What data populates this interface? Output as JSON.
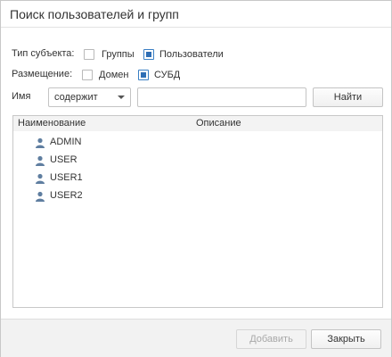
{
  "dialog": {
    "title": "Поиск пользователей и групп"
  },
  "filters": {
    "subject_type_label": "Тип субъекта:",
    "groups_label": "Группы",
    "groups_checked": false,
    "users_label": "Пользователи",
    "users_checked": true,
    "placement_label": "Размещение:",
    "domain_label": "Домен",
    "domain_checked": false,
    "dbms_label": "СУБД",
    "dbms_checked": true
  },
  "search": {
    "name_label": "Имя",
    "condition_value": "содержит",
    "query_value": "",
    "find_label": "Найти"
  },
  "table": {
    "columns": [
      "Наименование",
      "Описание"
    ],
    "rows": [
      {
        "name": "ADMIN",
        "description": ""
      },
      {
        "name": "USER",
        "description": ""
      },
      {
        "name": "USER1",
        "description": ""
      },
      {
        "name": "USER2",
        "description": ""
      }
    ]
  },
  "footer": {
    "add_label": "Добавить",
    "close_label": "Закрыть"
  },
  "colors": {
    "accent": "#2e6eb5",
    "user_icon": "#5f7ea0"
  }
}
